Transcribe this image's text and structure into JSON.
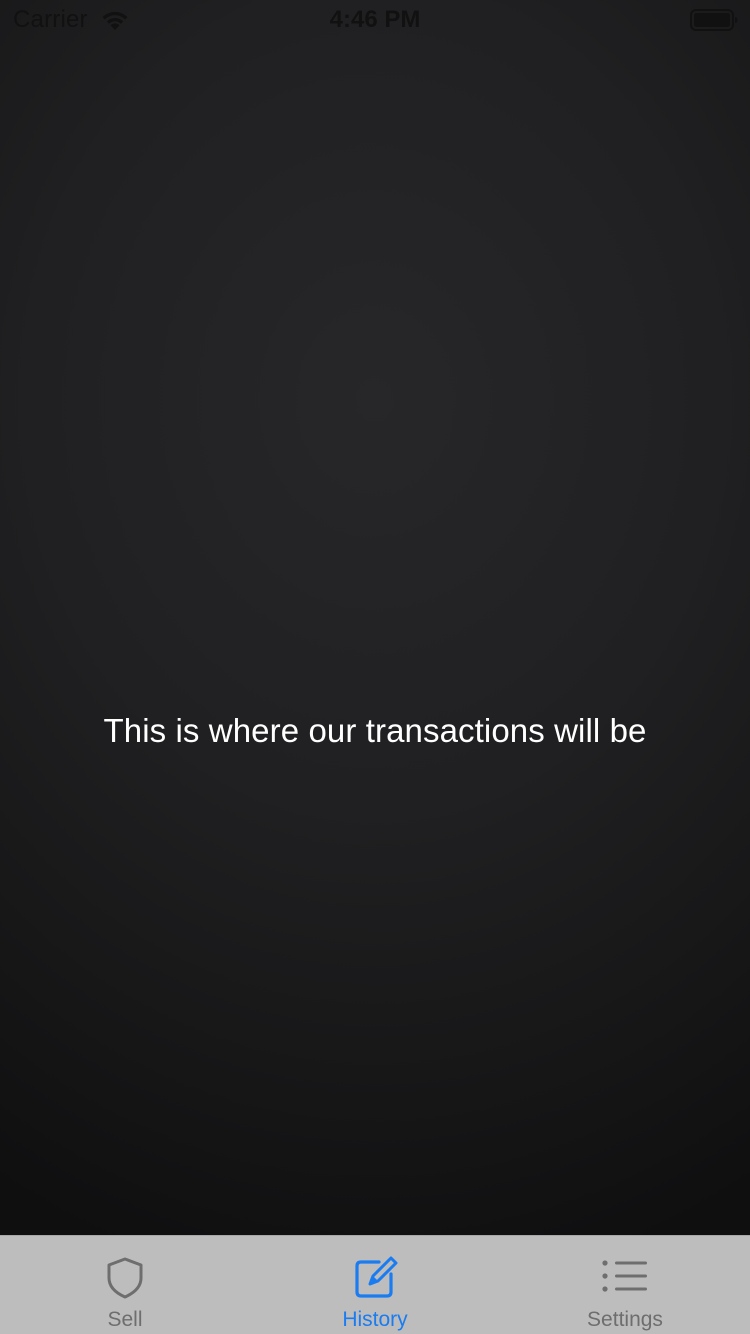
{
  "status_bar": {
    "carrier": "Carrier",
    "time": "4:46 PM",
    "wifi_icon": "wifi-icon",
    "battery_icon": "battery-full-icon"
  },
  "main": {
    "message": "This is where our transactions will be"
  },
  "tab_bar": {
    "active_color": "#1a7cf0",
    "inactive_color": "#6e6e6e",
    "tabs": [
      {
        "label": "Sell",
        "icon": "shield-icon",
        "active": false
      },
      {
        "label": "History",
        "icon": "compose-icon",
        "active": true
      },
      {
        "label": "Settings",
        "icon": "list-icon",
        "active": false
      }
    ]
  }
}
